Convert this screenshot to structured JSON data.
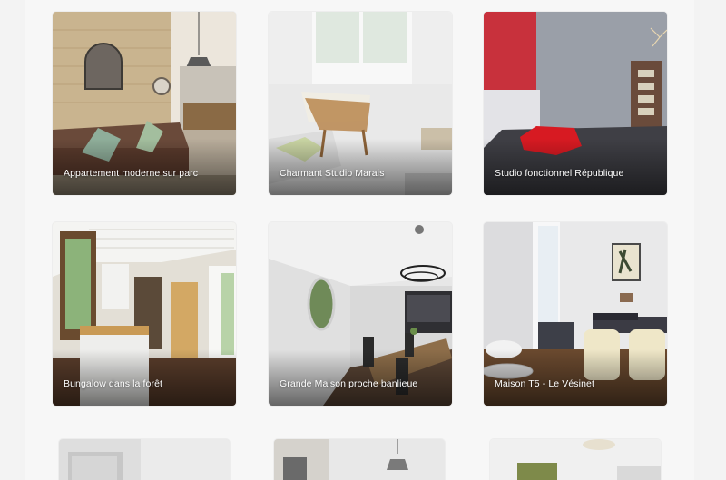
{
  "listings": [
    {
      "title": "Appartement moderne sur parc"
    },
    {
      "title": "Charmant Studio Marais"
    },
    {
      "title": "Studio fonctionnel République"
    },
    {
      "title": "Bungalow dans la forêt"
    },
    {
      "title": "Grande Maison proche banlieue"
    },
    {
      "title": "Maison T5 - Le Vésinet"
    }
  ],
  "colors": {
    "page_background": "#f3f3f3",
    "caption_text": "#ffffff"
  }
}
